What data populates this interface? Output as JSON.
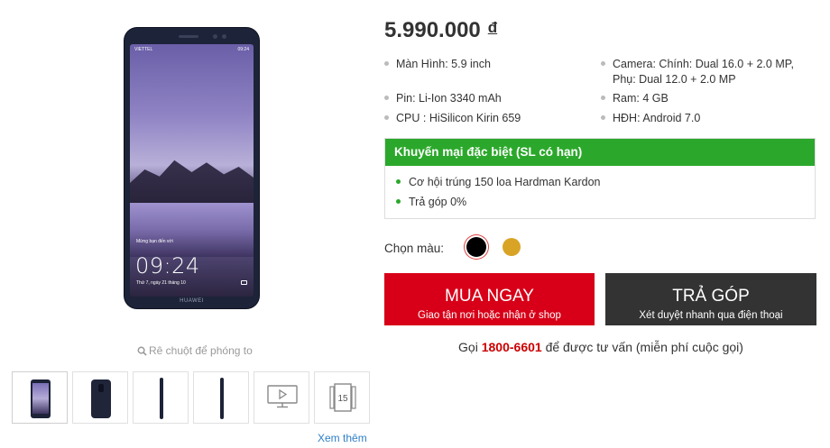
{
  "product": {
    "price": "5.990.000",
    "currency": "đ",
    "phone_screen": {
      "status_left": "VIETTEL",
      "status_right": "09:24",
      "welcome": "Mừng bạn đến với",
      "time": "09:24",
      "date": "Thứ 7, ngày 21 tháng 10",
      "brand": "HUAWEI"
    }
  },
  "gallery": {
    "zoom_hint": "Rê chuột để phóng to",
    "thumbnails": [
      {
        "kind": "front"
      },
      {
        "kind": "back"
      },
      {
        "kind": "side"
      },
      {
        "kind": "side"
      },
      {
        "kind": "video",
        "icon": "video-play-icon"
      },
      {
        "kind": "360",
        "icon": "rotate-360-icon",
        "label": "15"
      }
    ],
    "more_link": "Xem thêm"
  },
  "specs": [
    {
      "label": "Màn Hình:",
      "value": "5.9 inch"
    },
    {
      "label": "Camera:",
      "value": "Chính: Dual 16.0 + 2.0 MP,",
      "value2": "Phụ: Dual 12.0 + 2.0 MP"
    },
    {
      "label": "Pin:",
      "value": "Li-Ion 3340 mAh"
    },
    {
      "label": "Ram:",
      "value": "4 GB"
    },
    {
      "label": "CPU :",
      "value": "HiSilicon Kirin 659"
    },
    {
      "label": "HĐH:",
      "value": "Android 7.0"
    }
  ],
  "promo": {
    "title": "Khuyến mại đặc biệt (SL có hạn)",
    "items": [
      "Cơ hội trúng 150 loa Hardman Kardon",
      "Trả góp 0%"
    ],
    "accent": "#2ba82b"
  },
  "colors": {
    "label": "Chọn màu:",
    "options": [
      {
        "name": "black",
        "hex": "#000000",
        "selected": true
      },
      {
        "name": "gold",
        "hex": "#d9a425",
        "selected": false
      }
    ]
  },
  "buttons": {
    "buy": {
      "title": "MUA NGAY",
      "sub": "Giao tận nơi hoặc nhận ở shop",
      "color": "#d70018"
    },
    "installment": {
      "title": "TRẢ GÓP",
      "sub": "Xét duyệt nhanh qua điện thoại",
      "color": "#333333"
    }
  },
  "hotline": {
    "prefix": "Gọi",
    "number": "1800-6601",
    "suffix": "để được tư vấn (miễn phí cuộc gọi)"
  }
}
